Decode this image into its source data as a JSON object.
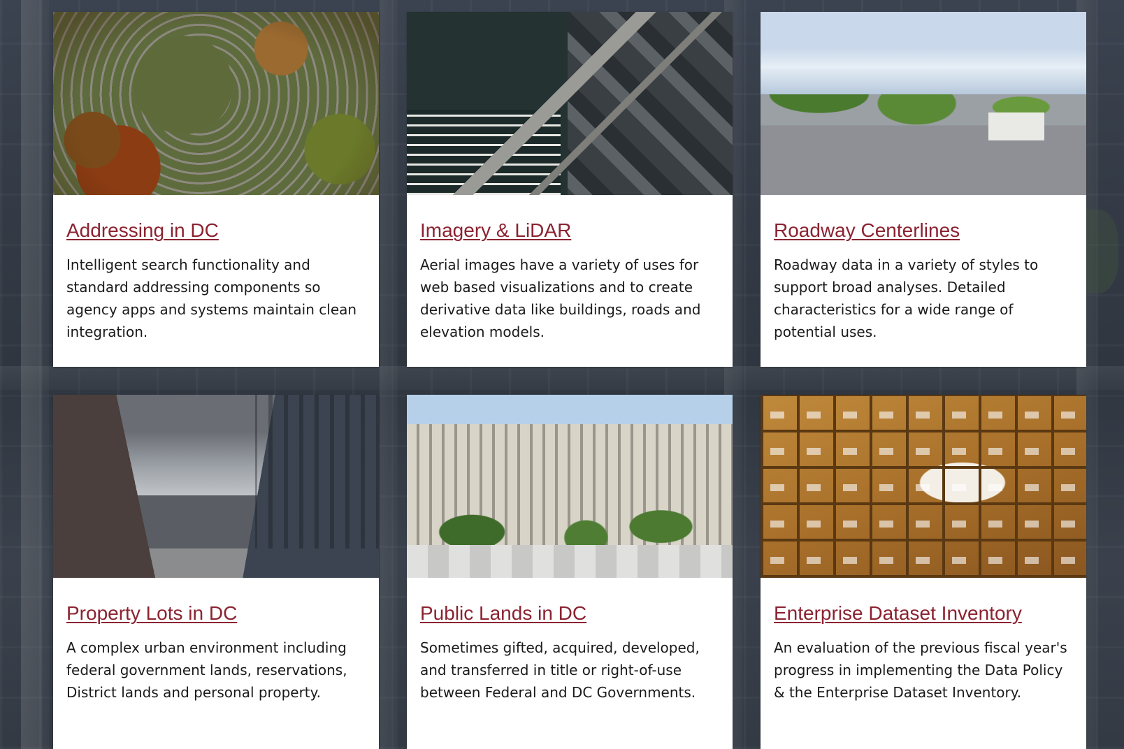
{
  "cards": [
    {
      "title": "Addressing in DC",
      "description": "Intelligent search functionality and standard addressing components so agency apps and systems maintain clean integration.",
      "image": "aerial-suburb-photo"
    },
    {
      "title": "Imagery & LiDAR",
      "description": "Aerial images have a variety of uses for web based visualizations and to create derivative data like buildings, roads and elevation models.",
      "image": "aerial-city-marina-photo"
    },
    {
      "title": "Roadway Centerlines",
      "description": "Roadway data in a variety of styles to support broad analyses. Detailed characteristics for a wide range of potential uses.",
      "image": "street-intersection-photo"
    },
    {
      "title": "Property Lots in DC",
      "description": "A complex urban environment including federal government lands, reservations, District lands and personal property.",
      "image": "urban-buildings-photo"
    },
    {
      "title": "Public Lands in DC",
      "description": "Sometimes gifted, acquired, developed, and transferred in title or right-of-use between Federal and DC Governments.",
      "image": "government-building-photo"
    },
    {
      "title": "Enterprise Dataset Inventory",
      "description": "An evaluation of the previous fiscal year's progress in implementing the Data Policy & the Enterprise Dataset Inventory.",
      "image": "card-catalog-photo"
    }
  ],
  "colors": {
    "link": "#8b2331",
    "card_background": "#ffffff",
    "page_background": "#343b46"
  }
}
